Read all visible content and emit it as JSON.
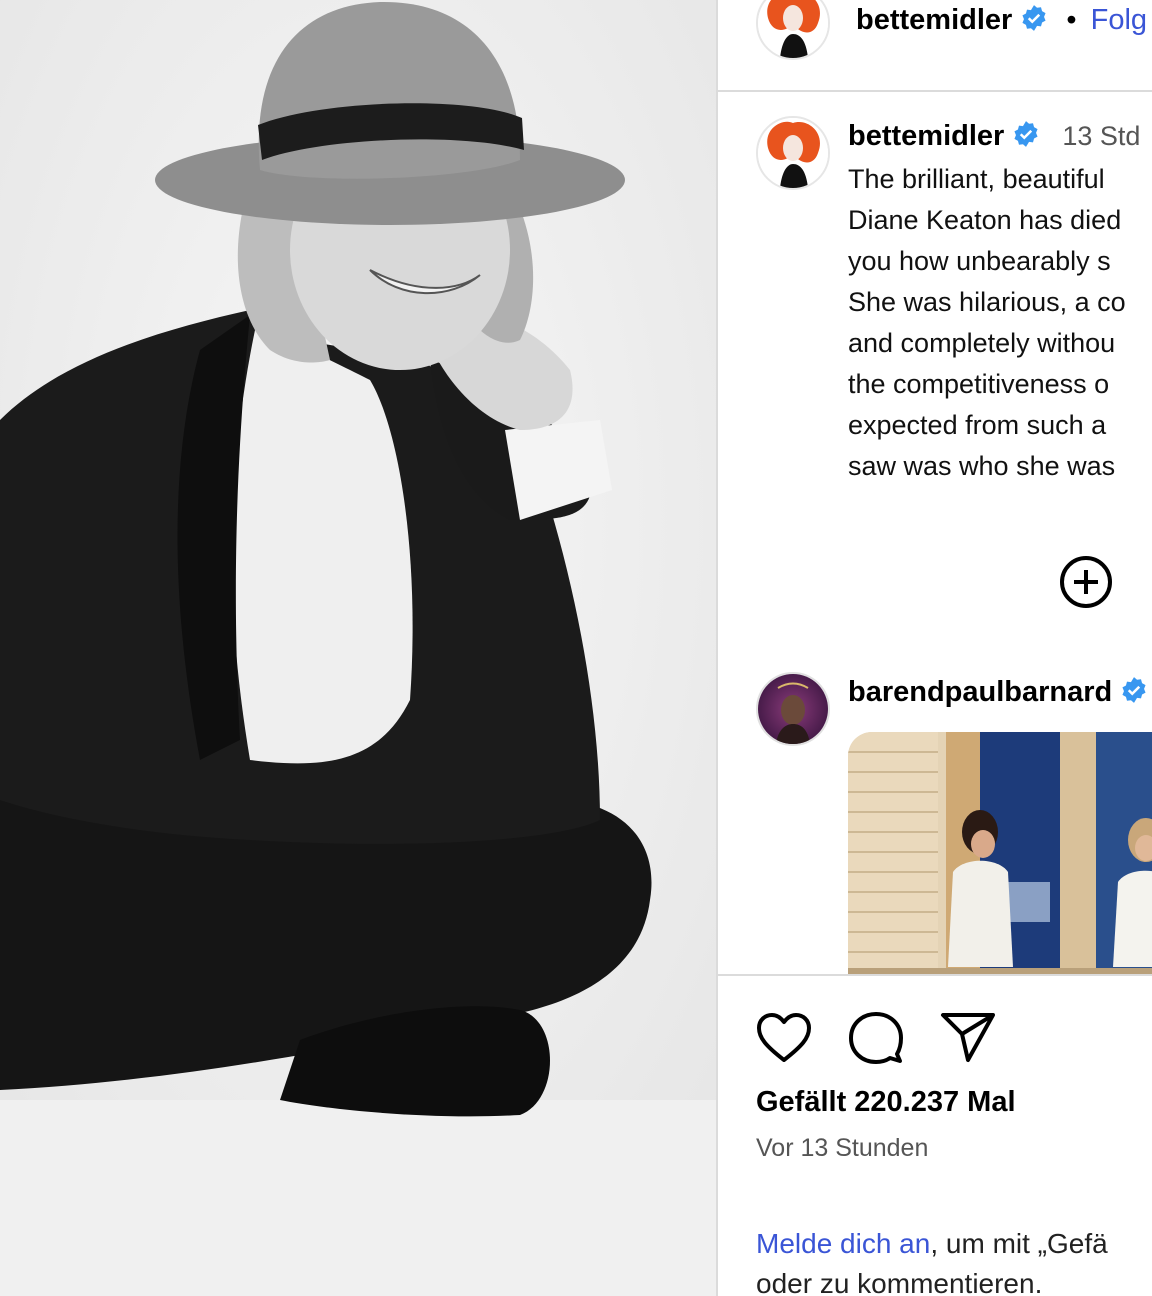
{
  "header": {
    "username": "bettemidler",
    "separator": "•",
    "follow_label": "Folg"
  },
  "caption": {
    "username": "bettemidler",
    "time": "13 Std",
    "lines": [
      "The brilliant, beautiful",
      "Diane Keaton has died",
      "you how unbearably s",
      "She was hilarious, a co",
      "and completely withou",
      "the competitiveness o",
      "expected from such a",
      "saw was who she was"
    ]
  },
  "comment": {
    "username": "barendpaulbarnard"
  },
  "actions": {
    "likes_text": "Gefällt 220.237 Mal",
    "timestamp": "Vor 13 Stunden"
  },
  "login": {
    "link_text": "Melde dich an",
    "rest_text": ", um mit „Gefä",
    "line2": "oder zu kommentieren."
  },
  "icons": {
    "verified": "verified-badge-icon",
    "more_comments": "plus-circle-icon",
    "like": "heart-icon",
    "comment": "speech-bubble-icon",
    "share": "paper-plane-icon"
  },
  "colors": {
    "link_blue": "#3a55d6",
    "verified_blue": "#3897f0",
    "avatar_orange": "#e8541e"
  }
}
